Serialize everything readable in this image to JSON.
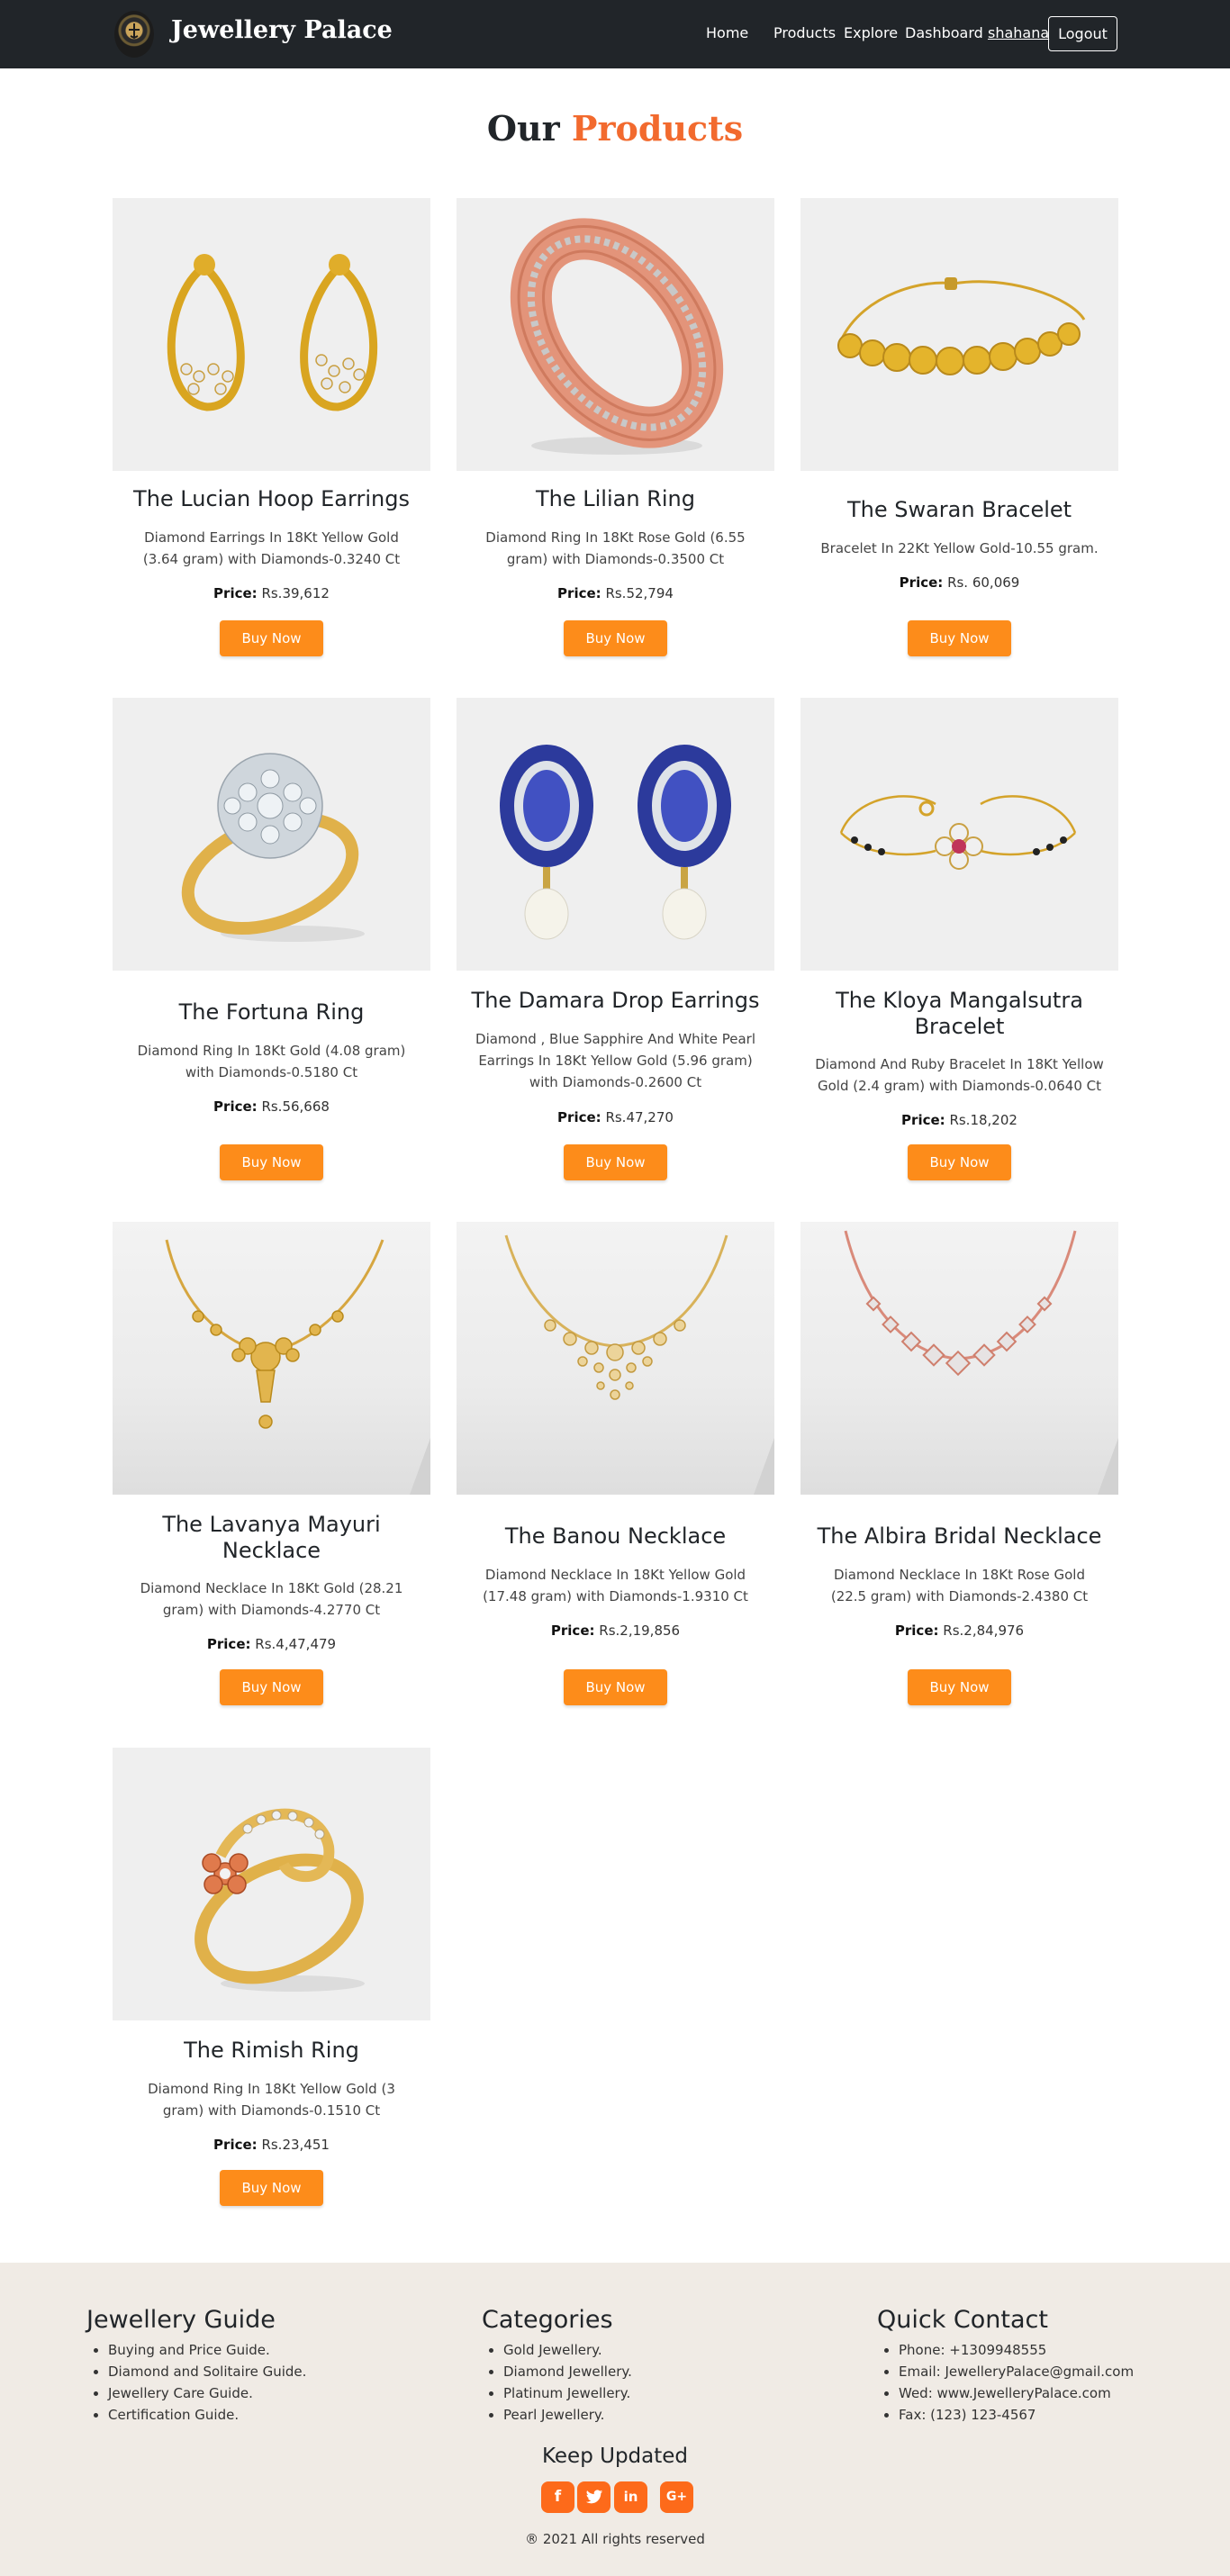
{
  "navbar": {
    "brand": "Jewellery Palace",
    "links": [
      "Home",
      "Products",
      "Explore",
      "Dashboard"
    ],
    "user": "shahana",
    "logout": "Logout"
  },
  "heading": {
    "part1": "Our",
    "part2": "Products",
    "accent_color": "#f26a2e"
  },
  "price_label": "Price:",
  "buy_label": "Buy Now",
  "products": [
    {
      "title": "The Lucian Hoop Earrings",
      "desc": "Diamond Earrings In 18Kt Yellow Gold (3.64 gram) with Diamonds-0.3240 Ct",
      "price": "Rs.39,612",
      "image": "hoop-earrings"
    },
    {
      "title": "The Lilian Ring",
      "desc": "Diamond Ring In 18Kt Rose Gold (6.55 gram) with Diamonds-0.3500 Ct",
      "price": "Rs.52,794",
      "image": "rose-gold-ring"
    },
    {
      "title": "The Swaran Bracelet",
      "desc": "Bracelet In 22Kt Yellow Gold-10.55 gram.",
      "price": "Rs. 60,069",
      "image": "gold-bracelet"
    },
    {
      "title": "The Fortuna Ring",
      "desc": "Diamond Ring In 18Kt Gold (4.08 gram) with Diamonds-0.5180 Ct",
      "price": "Rs.56,668",
      "image": "diamond-cluster-ring"
    },
    {
      "title": "The Damara Drop Earrings",
      "desc": "Diamond , Blue Sapphire And White Pearl Earrings In 18Kt Yellow Gold (5.96 gram) with Diamonds-0.2600 Ct",
      "price": "Rs.47,270",
      "image": "sapphire-drop-earrings"
    },
    {
      "title": "The Kloya Mangalsutra Bracelet",
      "desc": "Diamond And Ruby Bracelet In 18Kt Yellow Gold (2.4 gram) with Diamonds-0.0640 Ct",
      "price": "Rs.18,202",
      "image": "mangalsutra-bracelet"
    },
    {
      "title": "The Lavanya Mayuri Necklace",
      "desc": "Diamond Necklace In 18Kt Gold (28.21 gram) with Diamonds-4.2770 Ct",
      "price": "Rs.4,47,479",
      "image": "gold-pendant-necklace"
    },
    {
      "title": "The Banou Necklace",
      "desc": "Diamond Necklace In 18Kt Yellow Gold (17.48 gram) with Diamonds-1.9310 Ct",
      "price": "Rs.2,19,856",
      "image": "yellow-gold-necklace"
    },
    {
      "title": "The Albira Bridal Necklace",
      "desc": "Diamond Necklace In 18Kt Rose Gold (22.5 gram) with Diamonds-2.4380 Ct",
      "price": "Rs.2,84,976",
      "image": "rose-gold-necklace"
    },
    {
      "title": "The Rimish Ring",
      "desc": "Diamond Ring In 18Kt Yellow Gold (3 gram) with Diamonds-0.1510 Ct",
      "price": "Rs.23,451",
      "image": "swirl-ring"
    }
  ],
  "footer": {
    "guide": {
      "title": "Jewellery Guide",
      "items": [
        "Buying and Price Guide.",
        "Diamond and Solitaire Guide.",
        "Jewellery Care Guide.",
        "Certification Guide."
      ]
    },
    "categories": {
      "title": "Categories",
      "items": [
        "Gold Jewellery.",
        "Diamond Jewellery.",
        "Platinum Jewellery.",
        "Pearl Jewellery."
      ]
    },
    "contact": {
      "title": "Quick Contact",
      "items": [
        "Phone: +1309948555",
        "Email: JewelleryPalace@gmail.com",
        "Wed: www.JewelleryPalace.com",
        "Fax: (123) 123-4567"
      ]
    },
    "keep_updated": "Keep Updated",
    "social": [
      {
        "name": "facebook",
        "glyph": "f"
      },
      {
        "name": "twitter",
        "glyph": "t"
      },
      {
        "name": "linkedin",
        "glyph": "in"
      },
      {
        "name": "google-plus",
        "glyph": "G+"
      }
    ],
    "copyright": "® 2021 All rights reserved"
  },
  "colors": {
    "navbar_bg": "#212529",
    "button": "#fd8c1a",
    "footer_bg": "#f0ebe5",
    "social": "#fd6a1a"
  }
}
